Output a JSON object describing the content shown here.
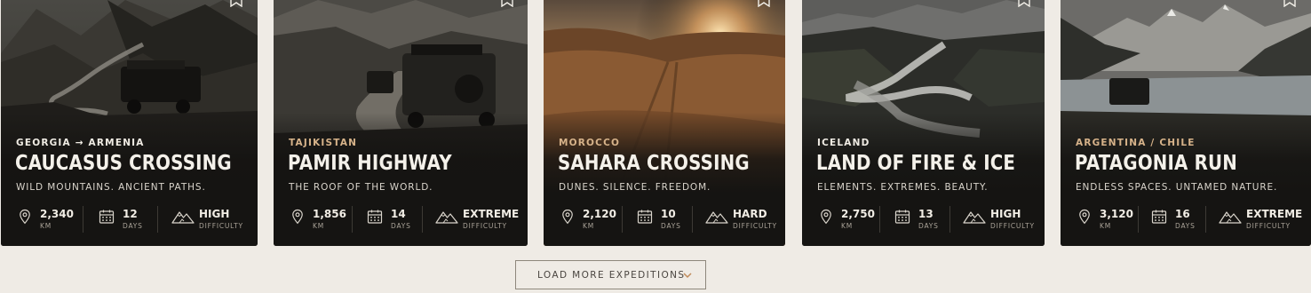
{
  "colors": {
    "accent": "#c08a5a",
    "region_gold": "#d7b38a",
    "card_bg": "#151412",
    "page_bg": "#efebe5"
  },
  "cards": [
    {
      "region": "GEORGIA → ARMENIA",
      "title": "CAUCASUS CROSSING",
      "tagline": "WILD MOUNTAINS. ANCIENT PATHS.",
      "distance": "2,340",
      "distance_unit": "KM",
      "duration": "12",
      "duration_unit": "DAYS",
      "difficulty": "HIGH",
      "difficulty_unit": "DIFFICULTY",
      "scene": "mountain-valley-river-4x4"
    },
    {
      "region": "TAJIKISTAN",
      "title": "PAMIR HIGHWAY",
      "tagline": "THE ROOF OF THE WORLD.",
      "distance": "1,856",
      "distance_unit": "KM",
      "duration": "14",
      "duration_unit": "DAYS",
      "difficulty": "EXTREME",
      "difficulty_unit": "DIFFICULTY",
      "scene": "dirt-road-two-4x4s"
    },
    {
      "region": "MOROCCO",
      "title": "SAHARA CROSSING",
      "tagline": "DUNES. SILENCE. FREEDOM.",
      "distance": "2,120",
      "distance_unit": "KM",
      "duration": "10",
      "duration_unit": "DAYS",
      "difficulty": "HARD",
      "difficulty_unit": "DIFFICULTY",
      "scene": "desert-dunes-sunset"
    },
    {
      "region": "ICELAND",
      "title": "LAND OF FIRE & ICE",
      "tagline": "ELEMENTS. EXTREMES. BEAUTY.",
      "distance": "2,750",
      "distance_unit": "KM",
      "duration": "13",
      "duration_unit": "DAYS",
      "difficulty": "HIGH",
      "difficulty_unit": "DIFFICULTY",
      "scene": "glacial-river-canyon"
    },
    {
      "region": "ARGENTINA / CHILE",
      "title": "PATAGONIA RUN",
      "tagline": "ENDLESS SPACES. UNTAMED NATURE.",
      "distance": "3,120",
      "distance_unit": "KM",
      "duration": "16",
      "duration_unit": "DAYS",
      "difficulty": "EXTREME",
      "difficulty_unit": "DIFFICULTY",
      "scene": "lake-peaks-4x4"
    }
  ],
  "load_more": {
    "label": "LOAD MORE EXPEDITIONS",
    "icon": "chevron-down-icon"
  }
}
